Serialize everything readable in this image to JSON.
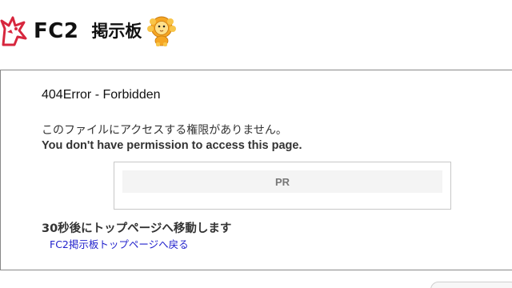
{
  "header": {
    "logo_text": "FC2",
    "board_name": "掲示板"
  },
  "error": {
    "title": "404Error - Forbidden",
    "message_ja": "このファイルにアクセスする権限がありません。",
    "message_en": "You don't have permission to access this page."
  },
  "ad": {
    "label": "PR"
  },
  "redirect": {
    "note": "30秒後にトップページへ移動します",
    "link_text": "FC2掲示板トップページへ戻る"
  },
  "colors": {
    "link": "#2222cc",
    "logo_red": "#d7263d",
    "lion_mane": "#f5a623"
  }
}
